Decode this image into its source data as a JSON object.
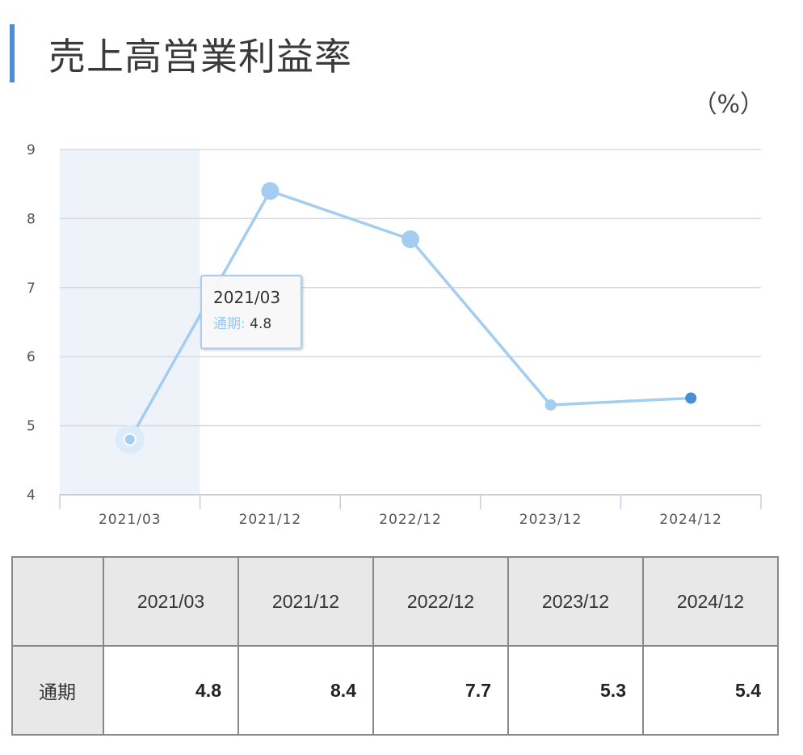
{
  "title": "売上高営業利益率",
  "unit": "（%）",
  "chart_data": {
    "type": "line",
    "categories": [
      "2021/03",
      "2021/12",
      "2022/12",
      "2023/12",
      "2024/12"
    ],
    "series": [
      {
        "name": "通期",
        "values": [
          4.8,
          8.4,
          7.7,
          5.3,
          5.4
        ]
      }
    ],
    "ylim": [
      4,
      9
    ],
    "yticks": [
      "4",
      "5",
      "6",
      "7",
      "8",
      "9"
    ],
    "grid": true,
    "highlighted_category": "2021/03",
    "colors": {
      "line": "#a4cdf2",
      "point": "#a4cdf2",
      "last_point": "#4a8fd6",
      "band": "#eef3f9",
      "grid": "#d8d8e0"
    }
  },
  "tooltip": {
    "date": "2021/03",
    "series_name": "通期:",
    "value": "4.8"
  },
  "table": {
    "headers": [
      "",
      "2021/03",
      "2021/12",
      "2022/12",
      "2023/12",
      "2024/12"
    ],
    "row_label": "通期",
    "values": [
      "4.8",
      "8.4",
      "7.7",
      "5.3",
      "5.4"
    ]
  }
}
